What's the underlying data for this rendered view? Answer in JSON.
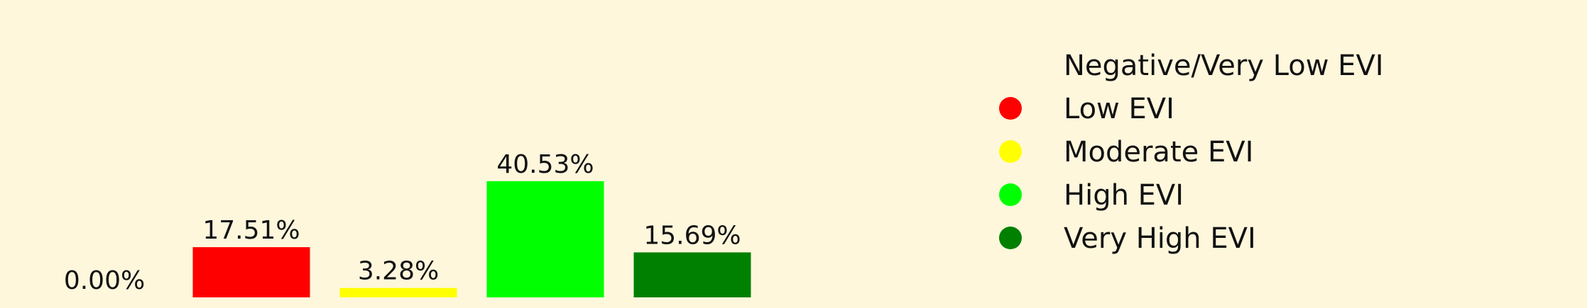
{
  "chart_data": {
    "type": "bar",
    "categories": [
      "Negative/Very Low EVI",
      "Low EVI",
      "Moderate EVI",
      "High EVI",
      "Very High EVI"
    ],
    "values": [
      0.0,
      17.51,
      3.28,
      40.53,
      15.69
    ],
    "value_labels": [
      "0.00%",
      "17.51%",
      "3.28%",
      "40.53%",
      "15.69%"
    ],
    "colors": [
      "#fef7dc",
      "#ff0000",
      "#ffff00",
      "#00ff00",
      "#008000"
    ],
    "title": "",
    "xlabel": "",
    "ylabel": "",
    "grid": false,
    "legend": {
      "placement": "right",
      "entries": [
        "Negative/Very Low EVI",
        "Low EVI",
        "Moderate EVI",
        "High EVI",
        "Very High EVI"
      ]
    }
  },
  "background_color": "#fef7dc"
}
